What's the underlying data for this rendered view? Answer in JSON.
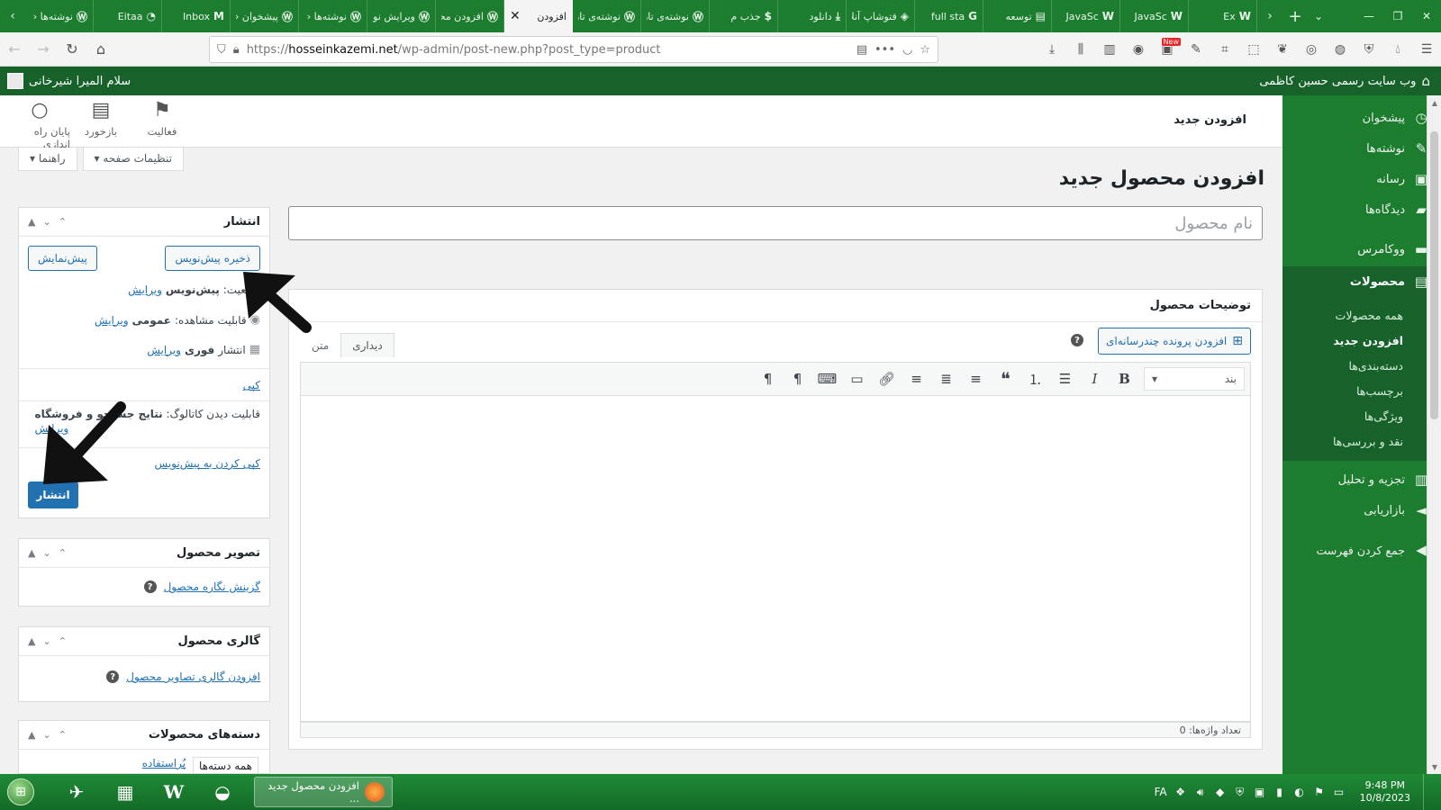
{
  "browser": {
    "tabs": [
      {
        "label": "نوشته‌ها ‹ و",
        "favicon": "wordpress-icon"
      },
      {
        "label": "Eitaa",
        "favicon": "eitaa-icon"
      },
      {
        "label": "Inbox",
        "favicon": "gmail-icon"
      },
      {
        "label": "پیشخوان ‹ و",
        "favicon": "wordpress-icon"
      },
      {
        "label": "نوشته‌ها ‹ و",
        "favicon": "wordpress-icon"
      },
      {
        "label": "ویرایش نوشته",
        "favicon": "wordpress-icon"
      },
      {
        "label": "افزودن محص",
        "favicon": "wordpress-icon"
      },
      {
        "label": "افزودن",
        "favicon": "wordpress-icon",
        "active": true
      },
      {
        "label": "نوشته‌ی تاز",
        "favicon": "wordpress-icon"
      },
      {
        "label": "نوشته‌ی تاز",
        "favicon": "wordpress-icon"
      },
      {
        "label": "جذب م",
        "favicon": "dollar-icon"
      },
      {
        "label": "دانلود",
        "favicon": "download-icon"
      },
      {
        "label": "فتوشاپ آنلا",
        "favicon": "photoshop-icon"
      },
      {
        "label": "full sta",
        "favicon": "google-icon"
      },
      {
        "label": "توسعه",
        "favicon": "page-icon"
      },
      {
        "label": "JavaSc",
        "favicon": "w3schools-icon"
      },
      {
        "label": "JavaSc",
        "favicon": "w3schools-icon"
      },
      {
        "label": "Ex",
        "favicon": "w3schools-icon"
      }
    ],
    "url_prefix": "https://",
    "url_domain": "hosseinkazemi.net",
    "url_path": "/wp-admin/post-new.php?post_type=product",
    "new_badge": "New"
  },
  "adminbar": {
    "site_name": "وب سایت رسمی حسین کاظمی",
    "greeting": "سلام المیرا شیرخانی"
  },
  "sidebar": {
    "items": [
      {
        "label": "پیشخوان",
        "icon": "dashboard-icon"
      },
      {
        "label": "نوشته‌ها",
        "icon": "pin-icon"
      },
      {
        "label": "رسانه",
        "icon": "media-icon"
      },
      {
        "label": "دیدگاه‌ها",
        "icon": "comment-icon"
      },
      {
        "label": "ووکامرس",
        "icon": "woo-icon"
      },
      {
        "label": "محصولات",
        "icon": "archive-icon",
        "current": true
      }
    ],
    "submenu": [
      "همه محصولات",
      "افزودن جدید",
      "دسته‌بندی‌ها",
      "برچسب‌ها",
      "ویژگی‌ها",
      "نقد و بررسی‌ها"
    ],
    "submenu_active_index": 1,
    "items_after": [
      {
        "label": "تجزیه و تحلیل",
        "icon": "chart-icon"
      },
      {
        "label": "بازاریابی",
        "icon": "megaphone-icon"
      }
    ],
    "collapse_label": "جمع کردن فهرست"
  },
  "header": {
    "title": "افزودن جدید",
    "actions": [
      {
        "label": "فعالیت",
        "icon": "flag-icon"
      },
      {
        "label": "بازخورد",
        "icon": "feedback-icon"
      },
      {
        "label": "پایان راه اندازی",
        "icon": "circle-icon"
      }
    ]
  },
  "screen_tabs": {
    "options": "تنظیمات صفحه",
    "help": "راهنما"
  },
  "page": {
    "title": "افزودن محصول جدید",
    "name_placeholder": "نام محصول"
  },
  "description": {
    "title": "توضیحات محصول",
    "add_media": "افزودن پرونده چندرسانه‌ای",
    "tab_visual": "دیداری",
    "tab_text": "متن",
    "format_select": "بند",
    "word_count": "تعداد واژه‌ها: 0"
  },
  "publish": {
    "title": "انتشار",
    "save_draft": "ذخیره پیش‌نویس",
    "preview": "پیش‌نمایش",
    "status_label": "وضعیت:",
    "status_value": "پیش‌نویس",
    "visibility_label": "قابلیت مشاهده:",
    "visibility_value": "عمومی",
    "publish_label": "انتشار",
    "publish_value": "فوری",
    "edit": "ویرایش",
    "copy": "کپی",
    "catalog_label": "قابلیت دیدن کاتالوگ:",
    "catalog_value": "نتایج جستجو و فروشگاه",
    "copy_to_draft": "کپی کردن به پیش‌نویس",
    "publish_button": "انتشار"
  },
  "image_box": {
    "title": "تصویر محصول",
    "link": "گزینش نگاره محصول"
  },
  "gallery_box": {
    "title": "گالری محصول",
    "link": "افزودن گالری تصاویر محصول"
  },
  "cats_box": {
    "title": "دسته‌های محصولات",
    "tab_all": "همه دسته‌ها",
    "tab_used": "پُراستفاده"
  },
  "taskbar": {
    "window_title": "افزودن محصول جدید ...",
    "lang": "FA",
    "time": "9:48 PM",
    "date": "10/8/2023"
  }
}
